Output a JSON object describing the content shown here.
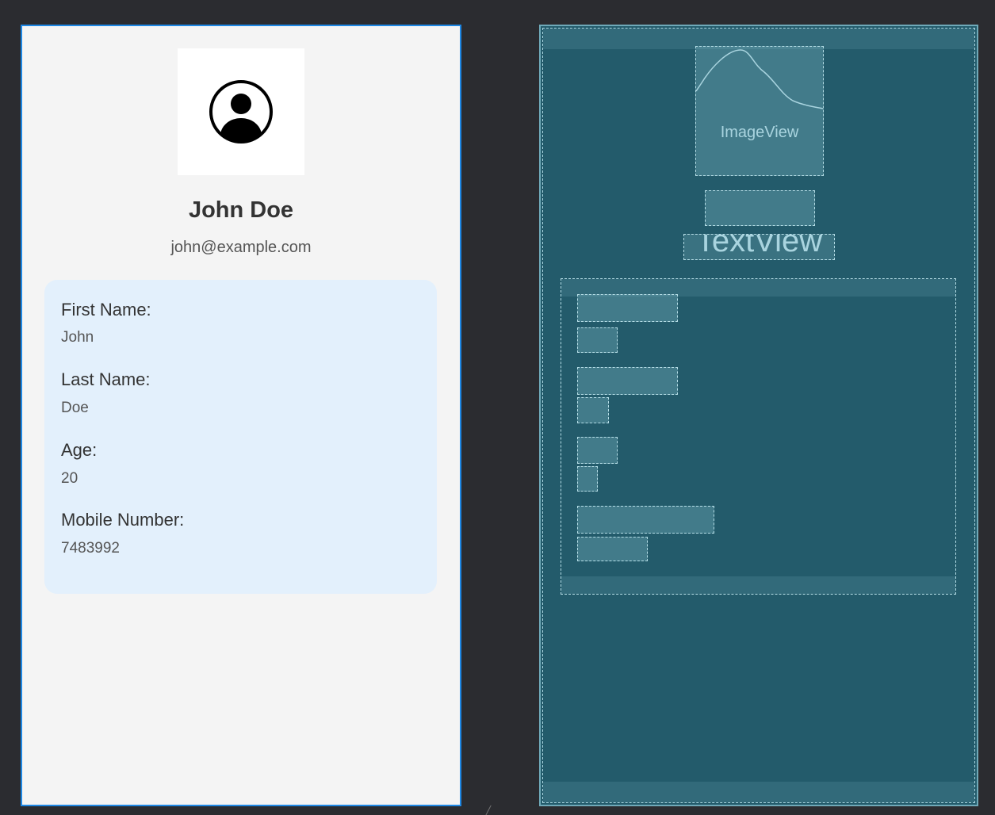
{
  "profile": {
    "name": "John Doe",
    "email": "john@example.com",
    "avatar_icon": "account-circle-icon"
  },
  "details": {
    "first_name_label": "First Name:",
    "first_name_value": "John",
    "last_name_label": "Last Name:",
    "last_name_value": "Doe",
    "age_label": "Age:",
    "age_value": "20",
    "mobile_label": "Mobile Number:",
    "mobile_value": "7483992"
  },
  "blueprint": {
    "image_label": "ImageView",
    "text_label": "TextView"
  },
  "colors": {
    "selection_border": "#1e88e5",
    "design_background": "#f4f4f4",
    "card_background": "#e3f0fc",
    "blueprint_background": "#235b6b",
    "editor_background": "#2b2c30"
  }
}
